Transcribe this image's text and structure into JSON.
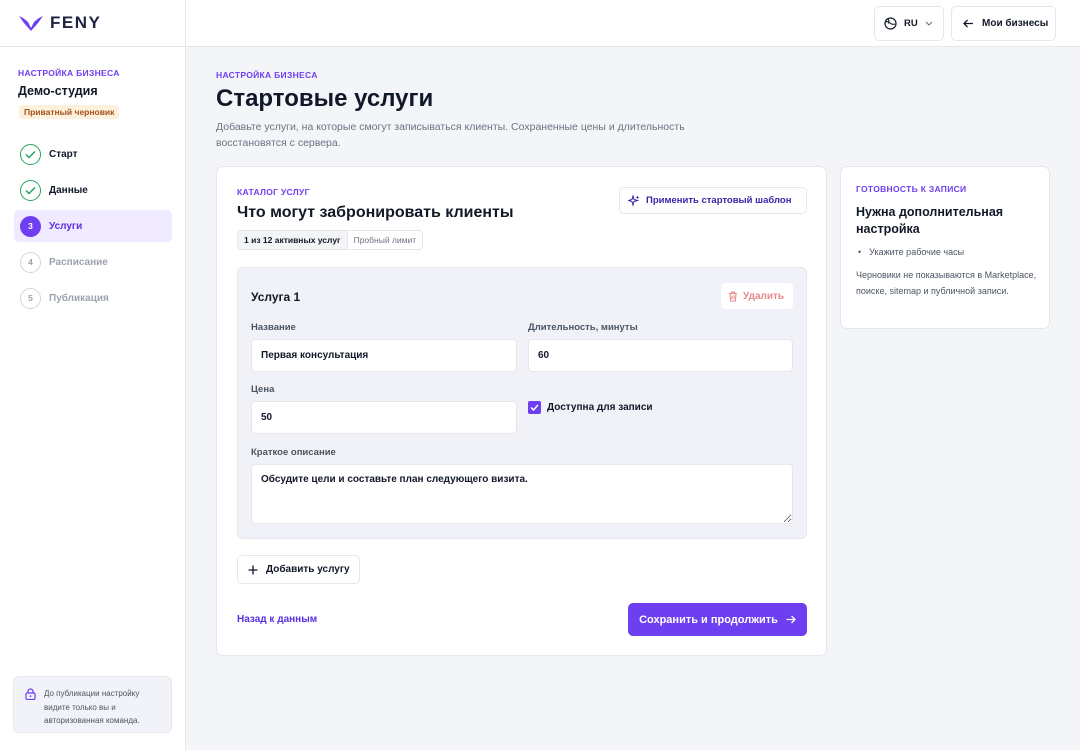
{
  "brand": {
    "name": "FENY"
  },
  "topbar": {
    "language": "RU",
    "businesses_label": "Мои бизнесы"
  },
  "sidebar": {
    "eyebrow": "НАСТРОЙКА БИЗНЕСА",
    "business_name": "Демо-студия",
    "badge": "Приватный черновик",
    "steps": [
      {
        "number": "1",
        "label": "Старт",
        "state": "done"
      },
      {
        "number": "2",
        "label": "Данные",
        "state": "done"
      },
      {
        "number": "3",
        "label": "Услуги",
        "state": "active"
      },
      {
        "number": "4",
        "label": "Расписание",
        "state": "pending"
      },
      {
        "number": "5",
        "label": "Публикация",
        "state": "pending"
      }
    ],
    "note": "До публикации настройку видите только вы и авторизованная команда."
  },
  "header": {
    "eyebrow": "НАСТРОЙКА БИЗНЕСА",
    "title": "Стартовые услуги",
    "description": "Добавьте услуги, на которые смогут записываться клиенты. Сохраненные цены и длительность восстановятся с сервера."
  },
  "catalog": {
    "eyebrow": "КАТАЛОГ УСЛУГ",
    "title": "Что могут забронировать клиенты",
    "active_count": "1 из 12 активных услуг",
    "trial_limit": "Пробный лимит",
    "template_button": "Применить стартовый шаблон",
    "service": {
      "title": "Услуга 1",
      "delete_label": "Удалить",
      "name_label": "Название",
      "name_value": "Первая консультация",
      "duration_label": "Длительность, минуты",
      "duration_value": "60",
      "price_label": "Цена",
      "price_value": "50",
      "available_label": "Доступна для записи",
      "available_checked": true,
      "description_label": "Краткое описание",
      "description_value": "Обсудите цели и составьте план следующего визита."
    },
    "add_button": "Добавить услугу",
    "back_link": "Назад к данным",
    "save_button": "Сохранить и продолжить"
  },
  "readiness": {
    "eyebrow": "ГОТОВНОСТЬ К ЗАПИСИ",
    "title": "Нужна дополнительная настройка",
    "items": [
      "Укажите рабочие часы"
    ],
    "note": "Черновики не показываются в Marketplace, поиске, sitemap и публичной записи."
  },
  "colors": {
    "accent": "#6d3ff0",
    "success": "#22a55b",
    "danger": "#e58a8a",
    "badge_bg": "#fdf0dc"
  }
}
